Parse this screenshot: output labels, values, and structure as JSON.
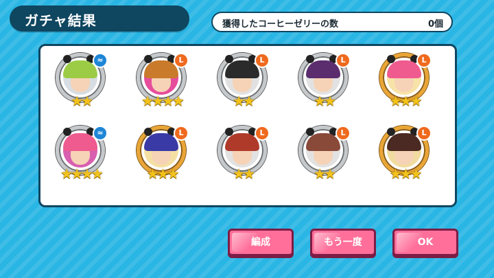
{
  "header": {
    "title": "ガチャ結果"
  },
  "counter": {
    "label": "獲得したコーヒーゼリーの数",
    "value": "0個"
  },
  "results": [
    {
      "badge": "blue",
      "frame": "silver",
      "stars": "★★",
      "hair": "#9ccc45",
      "bg": "#d7dde2"
    },
    {
      "badge": "orange",
      "frame": "silver",
      "stars": "★★★★",
      "hair": "#c97a2a",
      "bg": "#e64e9c"
    },
    {
      "badge": "orange",
      "frame": "silver",
      "stars": "★★",
      "hair": "#2b2b2b",
      "bg": "#e1e1e1"
    },
    {
      "badge": "orange",
      "frame": "silver",
      "stars": "★★",
      "hair": "#5b2d6e",
      "bg": "#e2e2e2"
    },
    {
      "badge": "orange",
      "frame": "gold",
      "stars": "★★★",
      "hair": "#ef5b8e",
      "bg": "#f7e3a7"
    },
    {
      "badge": "blue",
      "frame": "silver",
      "stars": "★★★★",
      "hair": "#ef5b8e",
      "bg": "#d85fb0"
    },
    {
      "badge": "orange",
      "frame": "gold",
      "stars": "★★★",
      "hair": "#3a3aa6",
      "bg": "#f4e0a2"
    },
    {
      "badge": "orange",
      "frame": "silver",
      "stars": "★★",
      "hair": "#b03a2a",
      "bg": "#e2e2e2"
    },
    {
      "badge": "orange",
      "frame": "silver",
      "stars": "★★",
      "hair": "#8a4a3a",
      "bg": "#e2e2e2"
    },
    {
      "badge": "orange",
      "frame": "gold",
      "stars": "★★★",
      "hair": "#4a2a22",
      "bg": "#f1dca0"
    }
  ],
  "buttons": {
    "edit": "編成",
    "again": "もう一度",
    "ok": "OK"
  }
}
